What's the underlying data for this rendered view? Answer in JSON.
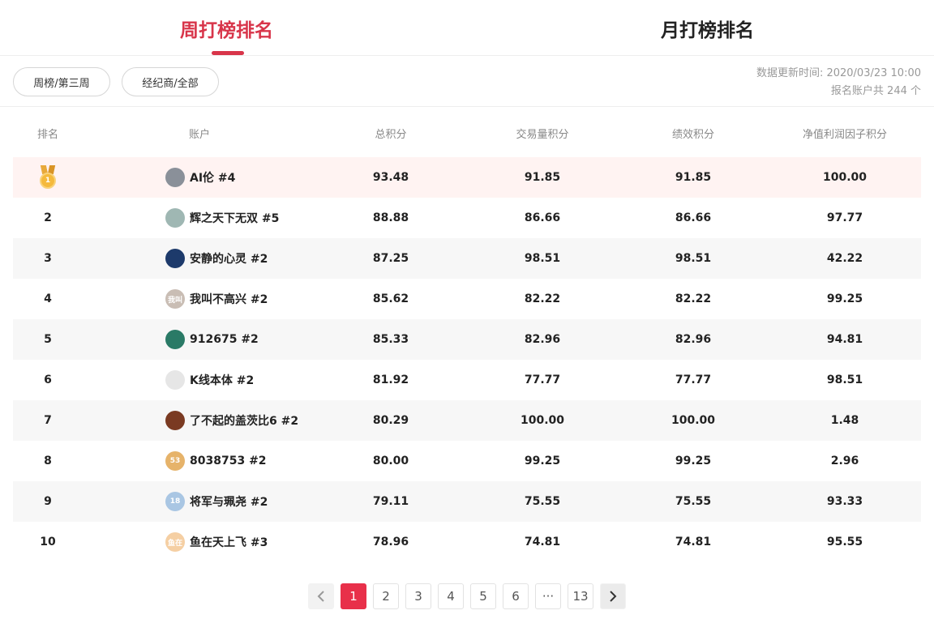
{
  "tabs": {
    "weekly": "周打榜排名",
    "monthly": "月打榜排名"
  },
  "filters": {
    "period": "周榜/第三周",
    "broker": "经纪商/全部"
  },
  "meta": {
    "updated": "数据更新时间: 2020/03/23 10:00",
    "count": "报名账户共 244 个"
  },
  "columns": {
    "rank": "排名",
    "account": "账户",
    "total": "总积分",
    "volume": "交易量积分",
    "performance": "绩效积分",
    "nav": "净值利润因子积分"
  },
  "rows": [
    {
      "rank": "1",
      "name": "AI伦 #4",
      "total": "93.48",
      "volume": "91.85",
      "performance": "91.85",
      "nav": "100.00",
      "avatar_color": "#8a9099",
      "avatar_text": ""
    },
    {
      "rank": "2",
      "name": "辉之天下无双 #5",
      "total": "88.88",
      "volume": "86.66",
      "performance": "86.66",
      "nav": "97.77",
      "avatar_color": "#9fb7b3",
      "avatar_text": ""
    },
    {
      "rank": "3",
      "name": "安静的心灵 #2",
      "total": "87.25",
      "volume": "98.51",
      "performance": "98.51",
      "nav": "42.22",
      "avatar_color": "#1d3a6b",
      "avatar_text": ""
    },
    {
      "rank": "4",
      "name": "我叫不高兴 #2",
      "total": "85.62",
      "volume": "82.22",
      "performance": "82.22",
      "nav": "99.25",
      "avatar_color": "#c9bdb4",
      "avatar_text": "我叫"
    },
    {
      "rank": "5",
      "name": "912675 #2",
      "total": "85.33",
      "volume": "82.96",
      "performance": "82.96",
      "nav": "94.81",
      "avatar_color": "#2a7a66",
      "avatar_text": ""
    },
    {
      "rank": "6",
      "name": "K线本体 #2",
      "total": "81.92",
      "volume": "77.77",
      "performance": "77.77",
      "nav": "98.51",
      "avatar_color": "#e6e6e6",
      "avatar_text": ""
    },
    {
      "rank": "7",
      "name": "了不起的盖茨比6 #2",
      "total": "80.29",
      "volume": "100.00",
      "performance": "100.00",
      "nav": "1.48",
      "avatar_color": "#7a3a22",
      "avatar_text": ""
    },
    {
      "rank": "8",
      "name": "8038753 #2",
      "total": "80.00",
      "volume": "99.25",
      "performance": "99.25",
      "nav": "2.96",
      "avatar_color": "#e6b36a",
      "avatar_text": "53"
    },
    {
      "rank": "9",
      "name": "将军与珮尧 #2",
      "total": "79.11",
      "volume": "75.55",
      "performance": "75.55",
      "nav": "93.33",
      "avatar_color": "#a9c6e3",
      "avatar_text": "18"
    },
    {
      "rank": "10",
      "name": "鱼在天上飞 #3",
      "total": "78.96",
      "volume": "74.81",
      "performance": "74.81",
      "nav": "95.55",
      "avatar_color": "#f5cfa3",
      "avatar_text": "鱼在"
    }
  ],
  "pagination": {
    "pages": [
      "1",
      "2",
      "3",
      "4",
      "5",
      "6",
      "···",
      "13"
    ],
    "current": "1",
    "prev_icon": "chevron-left-icon",
    "next_icon": "chevron-right-icon"
  },
  "colors": {
    "accent": "#d8354a",
    "highlight_row": "#fff3f2",
    "striped_row": "#f7f7f7"
  }
}
